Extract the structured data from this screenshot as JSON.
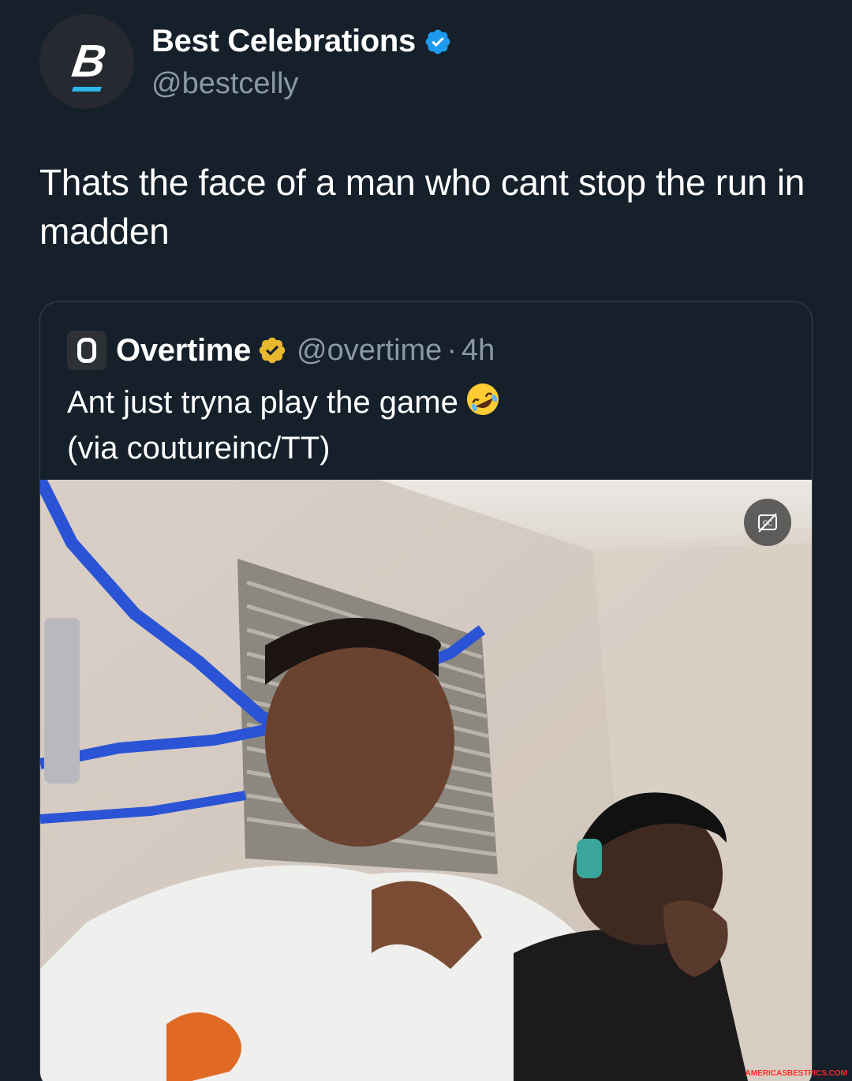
{
  "author": {
    "display_name": "Best Celebrations",
    "handle": "@bestcelly",
    "avatar_letter": "B",
    "verified_color": "#1d9bf0"
  },
  "tweet": {
    "text": "Thats the face of a man who cant stop the run in madden"
  },
  "quoted": {
    "display_name": "Overtime",
    "handle": "@overtime",
    "separator": "·",
    "time": "4h",
    "verified_color": "#e8b82e",
    "text_line1": "Ant just tryna play the game",
    "emoji": "rolling-on-the-floor-laughing",
    "text_line2": "(via coutureinc/TT)",
    "media": {
      "type": "video",
      "caption_button": "closed-captions-off-icon"
    }
  },
  "watermark": "AMERICASBESTPICS.COM",
  "colors": {
    "background": "#15202b",
    "secondary_text": "#8b98a5",
    "border": "#38444d"
  }
}
